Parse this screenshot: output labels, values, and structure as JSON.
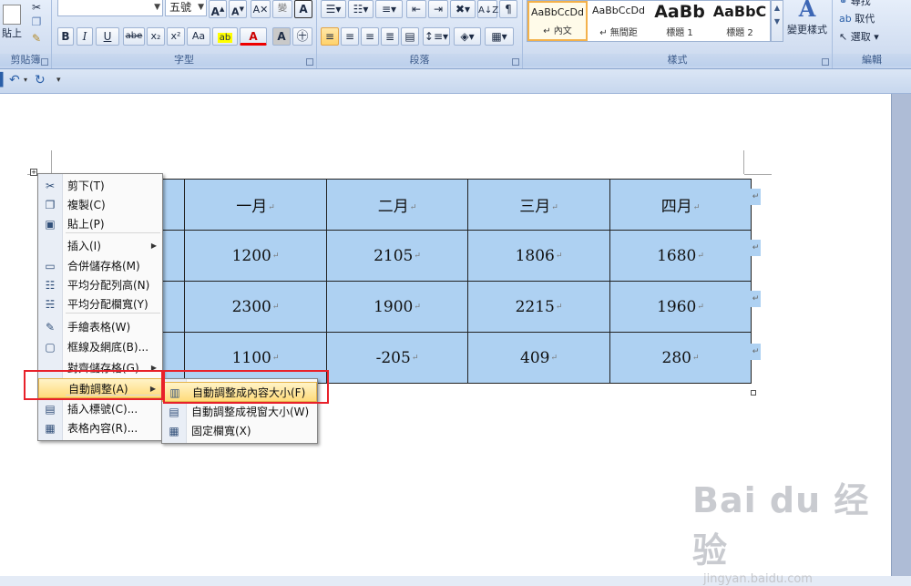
{
  "ribbon": {
    "clipboard": {
      "paste_label": "貼上",
      "group_label": "剪貼簿"
    },
    "font": {
      "size_value": "五號",
      "group_label": "字型",
      "buttons": [
        "B",
        "I",
        "U",
        "abe",
        "x₂",
        "x²",
        "Aa",
        "A",
        "A"
      ]
    },
    "paragraph": {
      "group_label": "段落"
    },
    "styles": {
      "group_label": "樣式",
      "change_styles_label": "變更樣式",
      "items": [
        {
          "sample": "AaBbCcDd",
          "name": "↵ 內文"
        },
        {
          "sample": "AaBbCcDd",
          "name": "↵ 無間距"
        },
        {
          "sample": "AaBb",
          "name": "標題 1"
        },
        {
          "sample": "AaBbC",
          "name": "標題 2"
        }
      ]
    },
    "editing": {
      "group_label": "編輯",
      "find_label": "尋找",
      "replace_label": "取代",
      "select_label": "選取"
    }
  },
  "table": {
    "header": [
      "",
      "一月",
      "二月",
      "三月",
      "四月"
    ],
    "rows": [
      [
        "",
        "1200",
        "2105",
        "1806",
        "1680"
      ],
      [
        "",
        "2300",
        "1900",
        "2215",
        "1960"
      ],
      [
        "",
        "1100",
        "-205",
        "409",
        "280"
      ]
    ]
  },
  "context_menu": {
    "items": [
      {
        "label": "剪下(T)",
        "icon": "scissors-icon"
      },
      {
        "label": "複製(C)",
        "icon": "copy-icon"
      },
      {
        "label": "貼上(P)",
        "icon": "paste-icon"
      },
      {
        "label": "插入(I)",
        "icon": "",
        "submenu": true
      },
      {
        "label": "合併儲存格(M)",
        "icon": "merge-cells-icon"
      },
      {
        "label": "平均分配列高(N)",
        "icon": "distribute-rows-icon"
      },
      {
        "label": "平均分配欄寬(Y)",
        "icon": "distribute-columns-icon"
      },
      {
        "label": "手繪表格(W)",
        "icon": "draw-table-icon"
      },
      {
        "label": "框線及網底(B)...",
        "icon": "borders-icon"
      },
      {
        "label": "對齊儲存格(G)",
        "icon": "",
        "submenu": true
      },
      {
        "label": "自動調整(A)",
        "icon": "",
        "submenu": true
      },
      {
        "label": "插入標號(C)...",
        "icon": "insert-caption-icon"
      },
      {
        "label": "表格內容(R)...",
        "icon": "table-properties-icon"
      }
    ]
  },
  "autofit_submenu": {
    "items": [
      {
        "label": "自動調整成內容大小(F)",
        "icon": "autofit-contents-icon"
      },
      {
        "label": "自動調整成視窗大小(W)",
        "icon": "autofit-window-icon"
      },
      {
        "label": "固定欄寬(X)",
        "icon": "fixed-column-width-icon"
      }
    ]
  },
  "watermark": {
    "logo_text": "Bai du 经验",
    "url_text": "jingyan.baidu.com"
  },
  "colors": {
    "cell_fill": "#aed1f2",
    "highlight": "#ffdb7a",
    "callout_red": "#e8212a"
  }
}
